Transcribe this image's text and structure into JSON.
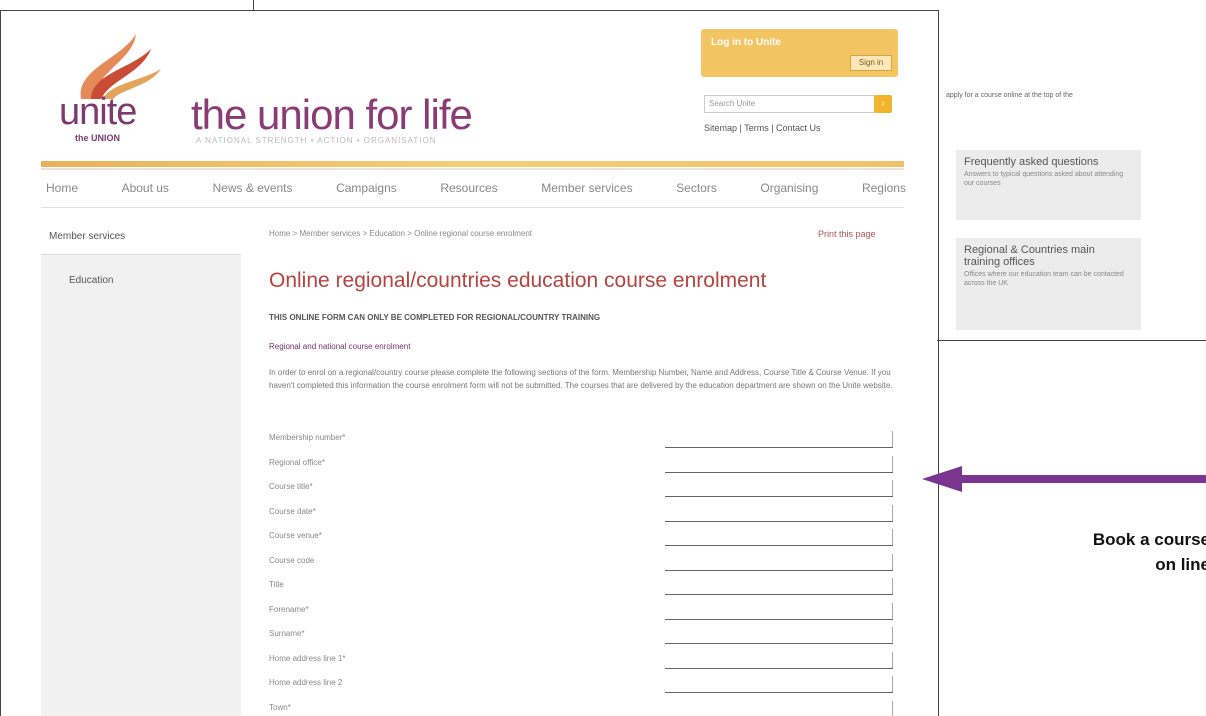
{
  "header": {
    "logo_text": "unite",
    "logo_sub": "the UNION",
    "tagline": "the union for life",
    "tagline_sub": "A NATIONAL STRENGTH • ACTION • ORGANISATION",
    "login_title": "Log in to Unite",
    "login_button": "Sign in",
    "search_placeholder": "Search Unite",
    "search_go": "›",
    "util_links": "Sitemap | Terms | Contact Us"
  },
  "nav": [
    "Home",
    "About us",
    "News & events",
    "Campaigns",
    "Resources",
    "Member services",
    "Sectors",
    "Organising",
    "Regions"
  ],
  "sidebar": {
    "items": [
      {
        "label": "Member services"
      },
      {
        "label": "Education"
      }
    ]
  },
  "main": {
    "breadcrumb": "Home > Member services > Education > Online regional course enrolment",
    "print_label": "Print this page",
    "title": "Online regional/countries education course enrolment",
    "warning": "THIS ONLINE FORM CAN ONLY BE COMPLETED FOR REGIONAL/COUNTRY TRAINING",
    "link_line": "Regional and national course enrolment",
    "paragraph": "In order to enrol on a regional/country course please complete the following sections of the form. Membership Number, Name and Address, Course Title & Course Venue. If you haven't completed this information the course enrolment form will not be submitted. The courses that are delivered by the education department are shown on the Unite website.",
    "fields": [
      "Membership number*",
      "Regional office*",
      "Course title*",
      "Course date*",
      "Course venue*",
      "Course code",
      "Title",
      "Forename*",
      "Surname*",
      "Home address line 1*",
      "Home address line 2",
      "Town*"
    ]
  },
  "right": {
    "top_text": "apply for a course online at the top of the",
    "box1_title": "Frequently asked questions",
    "box1_sub": "Answers to typical questions asked about attending our courses",
    "box2_title": "Regional & Countries main training offices",
    "box2_sub": "Offices where our education team can be contacted across the UK",
    "callout_line1": "Book a course",
    "callout_line2": "on line"
  },
  "colors": {
    "arrow": "#7a3590",
    "accent": "#f2c462",
    "title": "#b6433f"
  }
}
